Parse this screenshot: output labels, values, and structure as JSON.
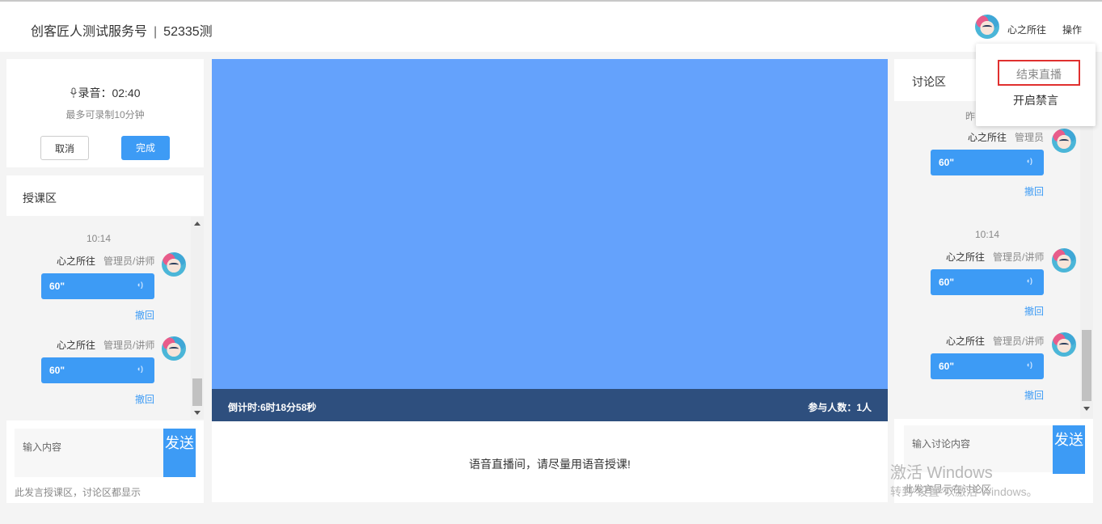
{
  "header": {
    "account": "创客匠人测试服务号",
    "separator": "|",
    "room": "52335测",
    "user": "心之所往",
    "operate": "操作"
  },
  "dropdown": {
    "end_live": "结束直播",
    "enable_mute": "开启禁言"
  },
  "recorder": {
    "label": "录音：02:40",
    "hint": "最多可录制10分钟",
    "cancel": "取消",
    "done": "完成"
  },
  "lesson": {
    "title": "授课区",
    "messages": [
      {
        "time": "10:14",
        "name": "心之所往",
        "role": "管理员/讲师",
        "duration": "60\"",
        "recall": "撤回"
      },
      {
        "time": "",
        "name": "心之所往",
        "role": "管理员/讲师",
        "duration": "60\"",
        "recall": "撤回"
      }
    ],
    "input_placeholder": "输入内容",
    "send": "发送",
    "note": "此发言授课区，讨论区都显示"
  },
  "stage": {
    "countdown": "倒计时:6时18分58秒",
    "participants": "参与人数：1人",
    "tip": "语音直播间，请尽量用语音授课!"
  },
  "discussion": {
    "title": "讨论区",
    "partial_time": "昨",
    "messages": [
      {
        "time": "",
        "name": "心之所往",
        "role": "管理员",
        "duration": "60\"",
        "recall": "撤回"
      },
      {
        "time": "10:14",
        "name": "心之所往",
        "role": "管理员/讲师",
        "duration": "60\"",
        "recall": "撤回"
      },
      {
        "time": "",
        "name": "心之所往",
        "role": "管理员/讲师",
        "duration": "60\"",
        "recall": "撤回"
      }
    ],
    "input_placeholder": "输入讨论内容",
    "send": "发送",
    "note": "此发言显示在讨论区"
  },
  "watermark": {
    "line1": "激活 Windows",
    "line2": "转到\"设置\"以激活 Windows。"
  },
  "colors": {
    "accent": "#3d9bf5",
    "stage": "#64a2fc",
    "stage_bar": "#2e4f7e",
    "highlight": "#e0302f"
  }
}
